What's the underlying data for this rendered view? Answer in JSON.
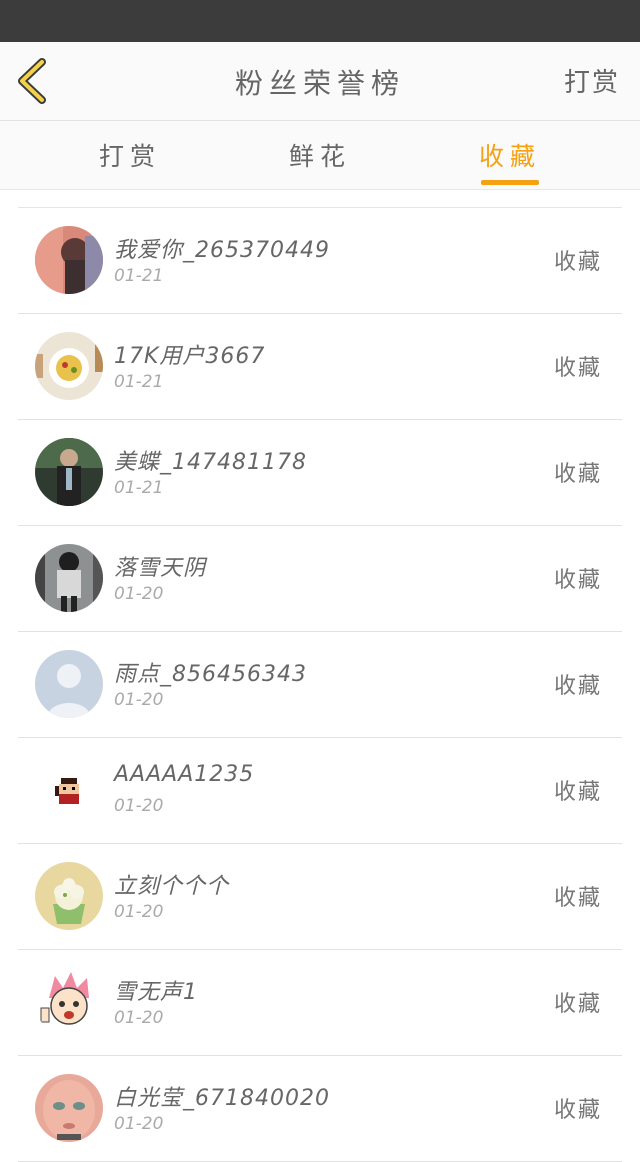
{
  "header": {
    "title": "粉丝荣誉榜",
    "right_label": "打赏"
  },
  "tabs": [
    {
      "label": "打赏",
      "active": false
    },
    {
      "label": "鲜花",
      "active": false
    },
    {
      "label": "收藏",
      "active": true
    }
  ],
  "accent_color": "#f5a111",
  "fans": [
    {
      "name": "我爱你_265370449",
      "date": "01-21",
      "action": "收藏",
      "avatar": "photo-avatar"
    },
    {
      "name": "17K用户3667",
      "date": "01-21",
      "action": "收藏",
      "avatar": "food-avatar"
    },
    {
      "name": "美蝶_147481178",
      "date": "01-21",
      "action": "收藏",
      "avatar": "photo-avatar"
    },
    {
      "name": "落雪天阴",
      "date": "01-20",
      "action": "收藏",
      "avatar": "photo-avatar"
    },
    {
      "name": "雨点_856456343",
      "date": "01-20",
      "action": "收藏",
      "avatar": "default-user-avatar"
    },
    {
      "name": "AAAAA1235",
      "date": "01-20",
      "action": "收藏",
      "avatar": "pixel-character-avatar"
    },
    {
      "name": "立刻个个个",
      "date": "01-20",
      "action": "收藏",
      "avatar": "cupcake-avatar"
    },
    {
      "name": "雪无声1",
      "date": "01-20",
      "action": "收藏",
      "avatar": "cartoon-avatar"
    },
    {
      "name": "白光莹_671840020",
      "date": "01-20",
      "action": "收藏",
      "avatar": "face-avatar"
    }
  ]
}
